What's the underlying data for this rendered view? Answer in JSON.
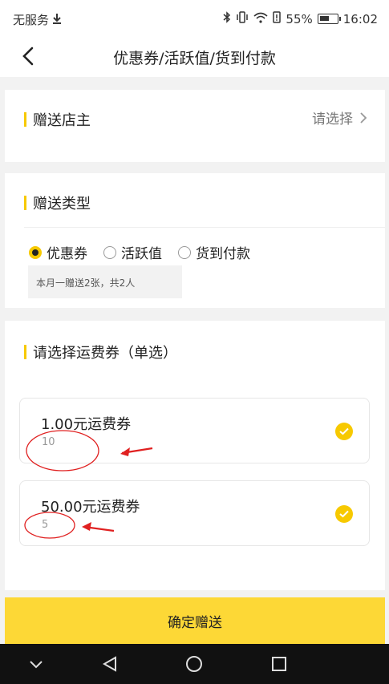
{
  "status_bar": {
    "carrier": "无服务",
    "battery": "55%",
    "time": "16:02"
  },
  "nav": {
    "title": "优惠券/活跃值/货到付款"
  },
  "owner_section": {
    "title": "赠送店主",
    "select_label": "请选择"
  },
  "type_section": {
    "title": "赠送类型",
    "options": [
      {
        "label": "优惠券",
        "selected": true
      },
      {
        "label": "活跃值",
        "selected": false
      },
      {
        "label": "货到付款",
        "selected": false
      }
    ],
    "hint": "本月一赠送2张，共2人"
  },
  "coupon_section": {
    "title": "请选择运费券（单选）",
    "coupons": [
      {
        "name": "1.00元运费券",
        "count": "10",
        "checked": true
      },
      {
        "name": "50.00元运费券",
        "count": "5",
        "checked": true
      }
    ]
  },
  "confirm_button": {
    "label": "确定赠送"
  },
  "colors": {
    "accent": "#f7c900",
    "button": "#fdd836",
    "annotation": "#e02020"
  }
}
